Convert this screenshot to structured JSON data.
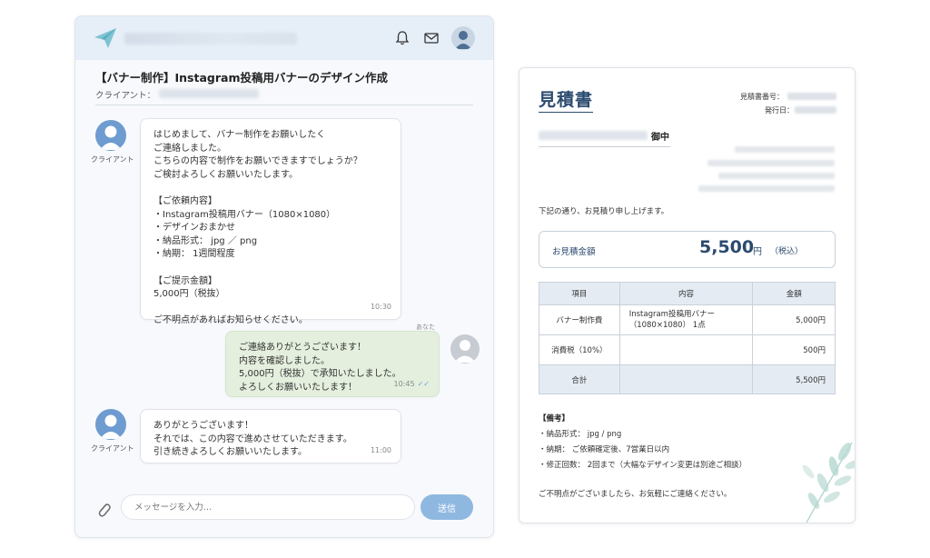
{
  "chat": {
    "job_title": "【バナー制作】Instagram投稿用バナーのデザイン作成",
    "client_label": "クライアント：",
    "messages": [
      {
        "sender_label": "クライアント",
        "lines": [
          "はじめまして、バナー制作をお願いしたく",
          "ご連絡しました。",
          "こちらの内容で制作をお願いできますでしょうか？",
          "ご検討よろしくお願いいたします。",
          "",
          "【ご依頼内容】",
          "・Instagram投稿用バナー（1080×1080）",
          "・デザインおまかせ",
          "・納品形式： jpg ／ png",
          "・納期： 1週間程度",
          "",
          "【ご提示金額】",
          "5,000円（税抜）",
          "",
          "ご不明点があればお知らせください。"
        ],
        "time": "10:30"
      },
      {
        "sender_label": "あなた",
        "lines": [
          "ご連絡ありがとうございます！",
          "内容を確認しました。",
          "5,000円（税抜）で承知いたしました。",
          "よろしくお願いいたします！"
        ],
        "time": "10:45",
        "read_mark": "✓✓"
      },
      {
        "sender_label": "クライアント",
        "lines": [
          "ありがとうございます！",
          "それでは、この内容で進めさせていただきます。",
          "引き続きよろしくお願いいたします。"
        ],
        "time": "11:00"
      }
    ],
    "input_placeholder": "メッセージを入力…",
    "send_label": "送信"
  },
  "quote": {
    "title": "見積書",
    "number_label": "見積書番号：",
    "date_label": "発行日：",
    "recipient_suffix": "御中",
    "intro": "下記の通り、お見積り申し上げます。",
    "total_label": "お見積金額",
    "total_amount": "5,500",
    "total_unit": "円",
    "total_tax_note": "（税込）",
    "table": {
      "headers": [
        "項目",
        "内容",
        "金額"
      ],
      "rows": [
        {
          "item": "バナー制作費",
          "desc": [
            "Instagram投稿用バナー",
            "（1080×1080） 1点"
          ],
          "amount": "5,000円"
        },
        {
          "item": "消費税（10%）",
          "desc": [],
          "amount": "500円"
        }
      ],
      "total_row": {
        "item": "合計",
        "amount": "5,500円"
      }
    },
    "notes_title": "【備考】",
    "notes": [
      "・納品形式： jpg / png",
      "・納期： ご依頼確定後、7営業日以内",
      "・修正回数： 2回まで（大幅なデザイン変更は別途ご相談）"
    ],
    "closing": "ご不明点がございましたら、お気軽にご連絡ください。"
  },
  "colors": {
    "accent_blue": "#2b4a6f",
    "send_button": "#8fb8e0",
    "own_bubble": "#e4efde",
    "avatar_blue": "#6e9bd0"
  },
  "icons": [
    "paper-plane-logo-icon",
    "bell-icon",
    "mail-icon",
    "user-avatar-icon",
    "paperclip-icon",
    "leaf-decoration-icon"
  ]
}
